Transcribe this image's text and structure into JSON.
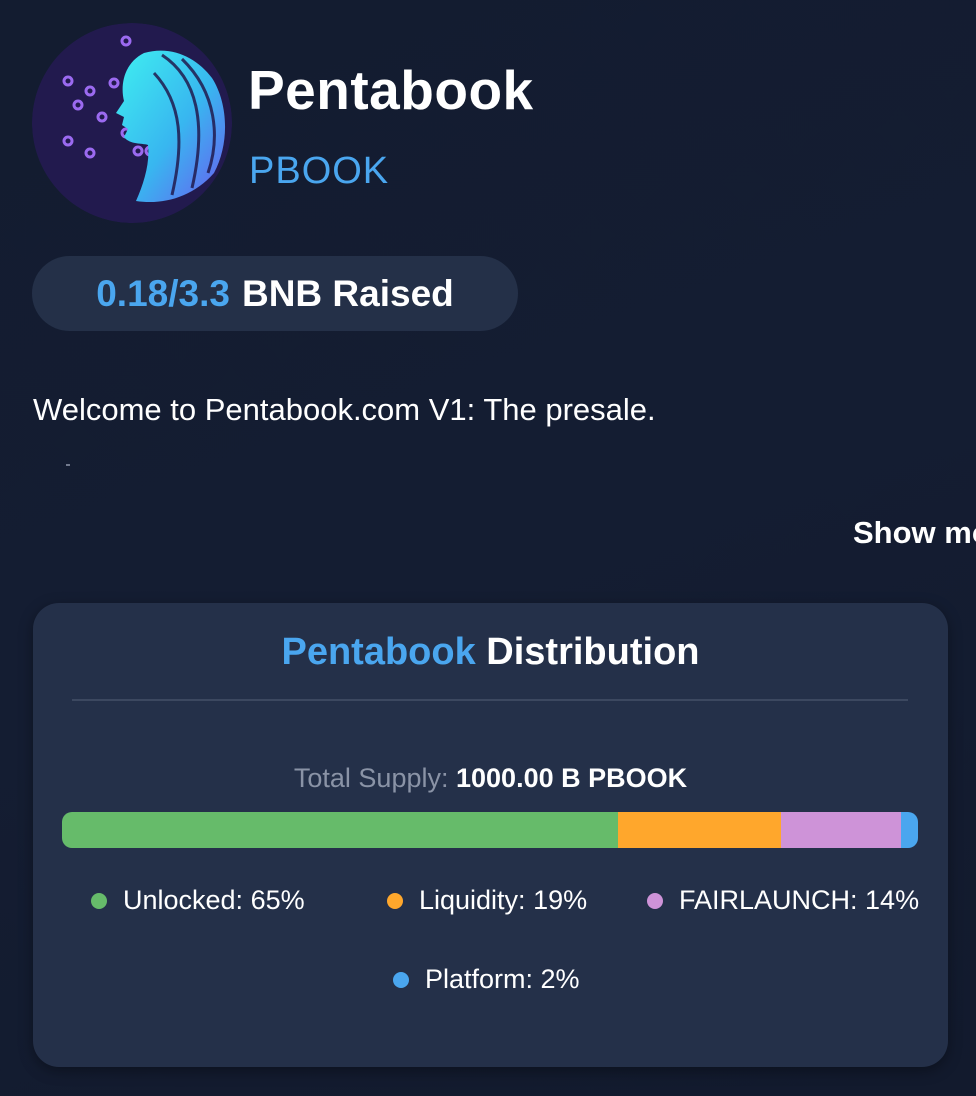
{
  "project": {
    "name": "Pentabook",
    "symbol": "PBOOK",
    "logo_icon": "cyber-woman-profile-logo"
  },
  "raised": {
    "amount": "0.18/3.3",
    "unit": "BNB Raised"
  },
  "description": {
    "text": "Welcome to Pentabook.com V1: The presale.",
    "show_more_label": "Show more"
  },
  "distribution": {
    "title_name": "Pentabook",
    "title_rest": "Distribution",
    "supply_label": "Total Supply:",
    "supply_value": "1000.00 B PBOOK",
    "items": [
      {
        "label": "Unlocked: 65%",
        "percent": 65,
        "color": "#66bb6a"
      },
      {
        "label": "Liquidity: 19%",
        "percent": 19,
        "color": "#ffa72c"
      },
      {
        "label": "FAIRLAUNCH: 14%",
        "percent": 14,
        "color": "#ce93d8"
      },
      {
        "label": "Platform: 2%",
        "percent": 2,
        "color": "#4aa6ef"
      }
    ]
  },
  "colors": {
    "accent": "#4aa6ef",
    "background": "#131c30",
    "card": "#243049"
  }
}
